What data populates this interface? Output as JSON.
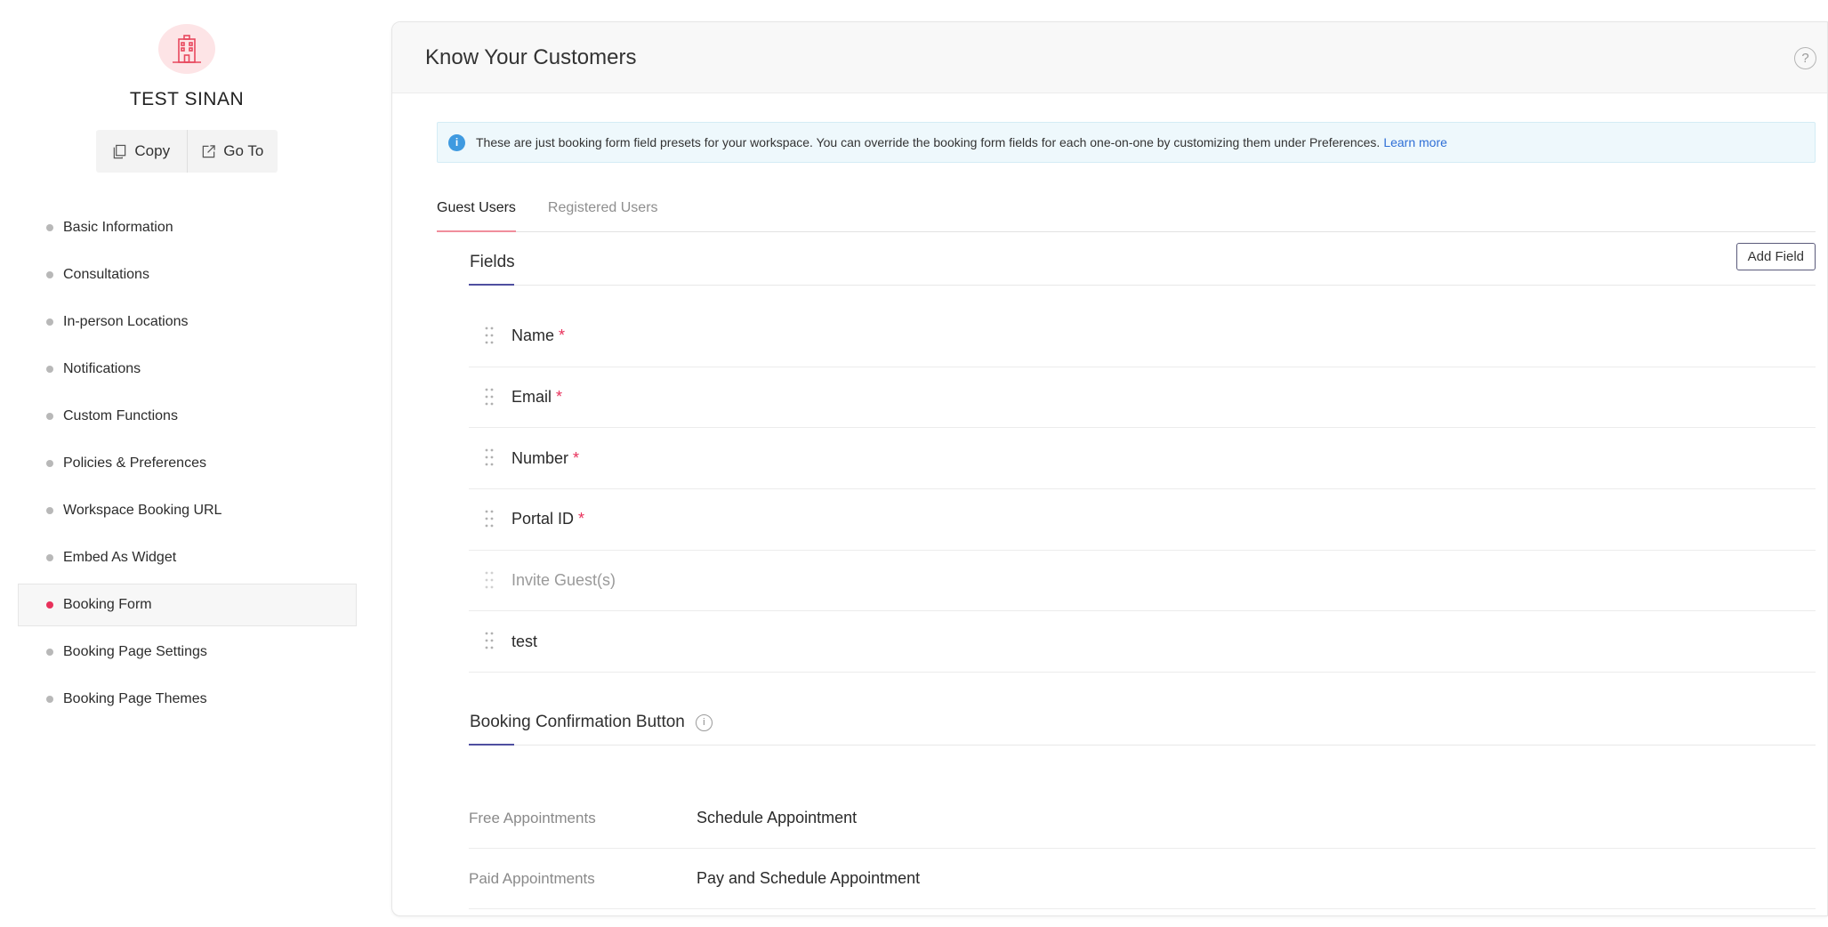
{
  "workspace": {
    "name": "TEST SINAN",
    "copy_label": "Copy",
    "goto_label": "Go To"
  },
  "nav": {
    "items": [
      {
        "label": "Basic Information"
      },
      {
        "label": "Consultations"
      },
      {
        "label": "In-person Locations"
      },
      {
        "label": "Notifications"
      },
      {
        "label": "Custom Functions"
      },
      {
        "label": "Policies & Preferences"
      },
      {
        "label": "Workspace Booking URL"
      },
      {
        "label": "Embed As Widget"
      },
      {
        "label": "Booking Form"
      },
      {
        "label": "Booking Page Settings"
      },
      {
        "label": "Booking Page Themes"
      }
    ],
    "active_index": 8
  },
  "header": {
    "title": "Know Your Customers",
    "help_glyph": "?"
  },
  "banner": {
    "icon_glyph": "i",
    "text": "These are just booking form field presets for your workspace. You can override the booking form fields for each one-on-one by customizing them under Preferences.",
    "link": "Learn more"
  },
  "tabs": [
    {
      "label": "Guest Users",
      "active": true
    },
    {
      "label": "Registered Users",
      "active": false
    }
  ],
  "fields_section": {
    "title": "Fields",
    "add_button": "Add Field",
    "rows": [
      {
        "label": "Name",
        "required": "*"
      },
      {
        "label": "Email",
        "required": "*"
      },
      {
        "label": "Number",
        "required": "*"
      },
      {
        "label": "Portal ID",
        "required": "*"
      },
      {
        "label": "Invite Guest(s)",
        "required": ""
      },
      {
        "label": "test",
        "required": ""
      }
    ]
  },
  "confirmation_section": {
    "title": "Booking Confirmation Button",
    "info_glyph": "i",
    "rows": [
      {
        "key": "Free Appointments",
        "value": "Schedule Appointment"
      },
      {
        "key": "Paid Appointments",
        "value": "Pay and Schedule Appointment"
      }
    ]
  },
  "colors": {
    "accent": "#e8315b",
    "section_underline": "#4f4fa0",
    "tab_underline": "#f08e9c",
    "link": "#2f6fd6",
    "info_icon": "#3f9ae0"
  },
  "icons": {
    "workspace": "building-icon",
    "copy": "copy-icon",
    "goto": "external-link-icon",
    "help": "help-icon",
    "drag": "drag-handle-icon"
  }
}
